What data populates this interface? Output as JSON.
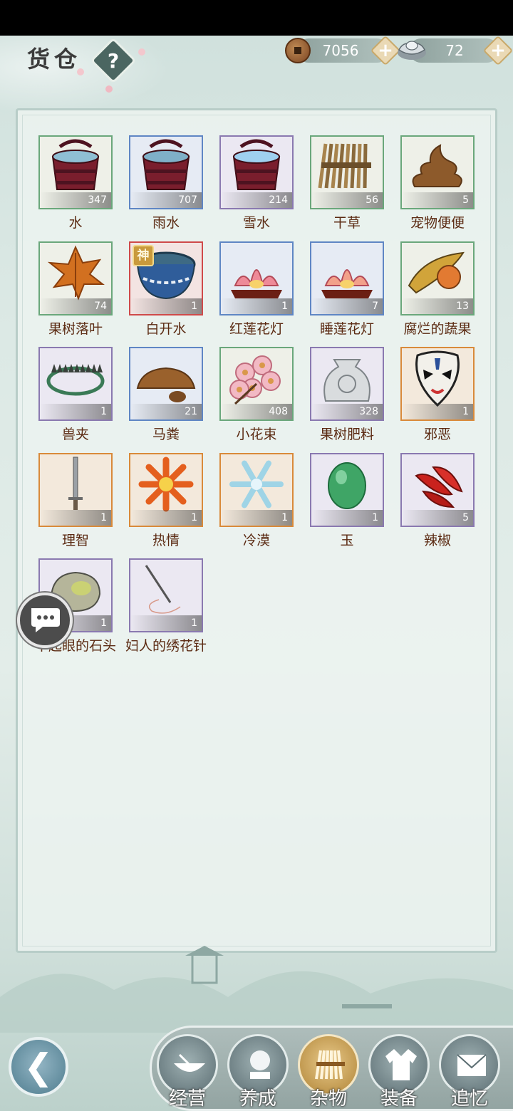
{
  "header": {
    "title": "货仓",
    "help_label": "?"
  },
  "currency": {
    "copper": "7056",
    "silver": "72",
    "plus": "+"
  },
  "items": [
    {
      "name": "水",
      "count": "347",
      "rarity": "green",
      "icon": "water-bucket-icon"
    },
    {
      "name": "雨水",
      "count": "707",
      "rarity": "blue",
      "icon": "rain-water-bucket-icon"
    },
    {
      "name": "雪水",
      "count": "214",
      "rarity": "purple",
      "icon": "snow-water-bucket-icon"
    },
    {
      "name": "干草",
      "count": "56",
      "rarity": "green",
      "icon": "hay-icon"
    },
    {
      "name": "宠物便便",
      "count": "5",
      "rarity": "green",
      "icon": "pet-poop-icon"
    },
    {
      "name": "果树落叶",
      "count": "74",
      "rarity": "green",
      "icon": "fallen-leaf-icon"
    },
    {
      "name": "白开水",
      "count": "1",
      "rarity": "red",
      "icon": "boiled-water-bowl-icon",
      "badge": "神"
    },
    {
      "name": "红莲花灯",
      "count": "1",
      "rarity": "blue",
      "icon": "red-lotus-lamp-icon"
    },
    {
      "name": "睡莲花灯",
      "count": "7",
      "rarity": "blue",
      "icon": "water-lily-lamp-icon"
    },
    {
      "name": "腐烂的蔬果",
      "count": "13",
      "rarity": "green",
      "icon": "rotten-fruit-icon"
    },
    {
      "name": "兽夹",
      "count": "1",
      "rarity": "purple",
      "icon": "animal-trap-icon"
    },
    {
      "name": "马粪",
      "count": "21",
      "rarity": "blue",
      "icon": "horse-dung-icon"
    },
    {
      "name": "小花束",
      "count": "408",
      "rarity": "green",
      "icon": "flower-bouquet-icon"
    },
    {
      "name": "果树肥料",
      "count": "328",
      "rarity": "purple",
      "icon": "fertilizer-sack-icon"
    },
    {
      "name": "邪恶",
      "count": "1",
      "rarity": "orange",
      "icon": "opera-mask-icon"
    },
    {
      "name": "理智",
      "count": "1",
      "rarity": "orange",
      "icon": "sword-icon"
    },
    {
      "name": "热情",
      "count": "1",
      "rarity": "orange",
      "icon": "flame-flower-icon"
    },
    {
      "name": "冷漠",
      "count": "1",
      "rarity": "orange",
      "icon": "snowflake-icon"
    },
    {
      "name": "玉",
      "count": "1",
      "rarity": "purple",
      "icon": "jade-icon"
    },
    {
      "name": "辣椒",
      "count": "5",
      "rarity": "purple",
      "icon": "chili-pepper-icon"
    },
    {
      "name": "不起眼的石头",
      "count": "1",
      "rarity": "purple",
      "icon": "stone-icon"
    },
    {
      "name": "妇人的绣花针",
      "count": "1",
      "rarity": "purple",
      "icon": "embroidery-needle-icon"
    }
  ],
  "tabs": [
    {
      "label": "经营",
      "icon": "bowl-icon",
      "active": false
    },
    {
      "label": "养成",
      "icon": "crystal-ball-icon",
      "active": false
    },
    {
      "label": "杂物",
      "icon": "bundle-icon",
      "active": true
    },
    {
      "label": "装备",
      "icon": "robe-icon",
      "active": false
    },
    {
      "label": "追忆",
      "icon": "letter-icon",
      "active": false
    }
  ],
  "colors": {
    "green": "#6aa77b",
    "blue": "#5f86c4",
    "purple": "#8a79b0",
    "orange": "#d98a3a",
    "red": "#cf4a4a",
    "item_text": "#5b2a12"
  }
}
